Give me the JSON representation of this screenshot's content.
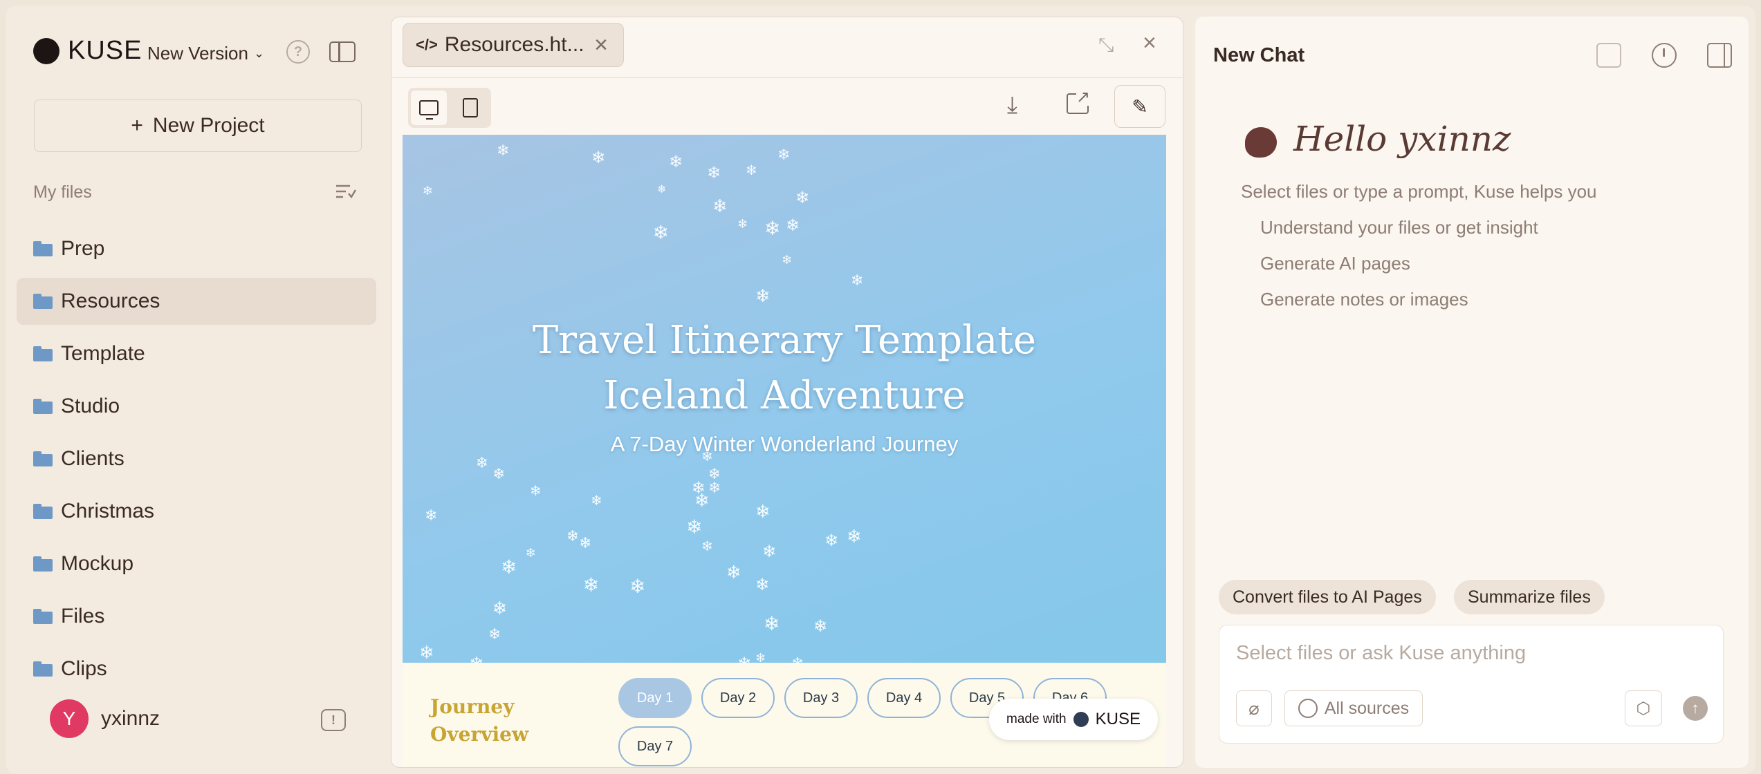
{
  "sidebar": {
    "logo_text": "KUSE",
    "version_label": "New Version",
    "new_project_label": "New Project",
    "my_files_label": "My files",
    "folders": [
      "Prep",
      "Resources",
      "Template",
      "Studio",
      "Clients",
      "Christmas",
      "Mockup",
      "Files",
      "Clips"
    ],
    "active_folder": "Resources",
    "user": {
      "initial": "Y",
      "name": "yxinnz",
      "avatar_color": "#e03a63"
    }
  },
  "preview": {
    "tab_label": "Resources.ht...",
    "hero": {
      "title_line1": "Travel Itinerary Template",
      "title_line2": "Iceland Adventure",
      "subtitle": "A 7-Day Winter Wonderland Journey"
    },
    "journey": {
      "title_line1": "Journey",
      "title_line2": "Overview",
      "days": [
        "Day 1",
        "Day 2",
        "Day 3",
        "Day 4",
        "Day 5",
        "Day 6",
        "Day 7"
      ],
      "active_day": "Day 1"
    },
    "badge": {
      "prefix": "made with",
      "logo": "KUSE"
    }
  },
  "chat": {
    "title": "New Chat",
    "greeting": "Hello yxinnz",
    "intro": "Select files or type a prompt, Kuse helps you",
    "hints": [
      "Understand your files or get insight",
      "Generate AI pages",
      "Generate notes or images"
    ],
    "suggestions": [
      "Convert files to AI Pages",
      "Summarize files"
    ],
    "composer_placeholder": "Select files or ask Kuse anything",
    "sources_label": "All sources"
  },
  "colors": {
    "accent": "#e03a63",
    "folder": "#6e98c6",
    "hero_sky": "#91c9ec",
    "journey_gold": "#c8a433"
  }
}
